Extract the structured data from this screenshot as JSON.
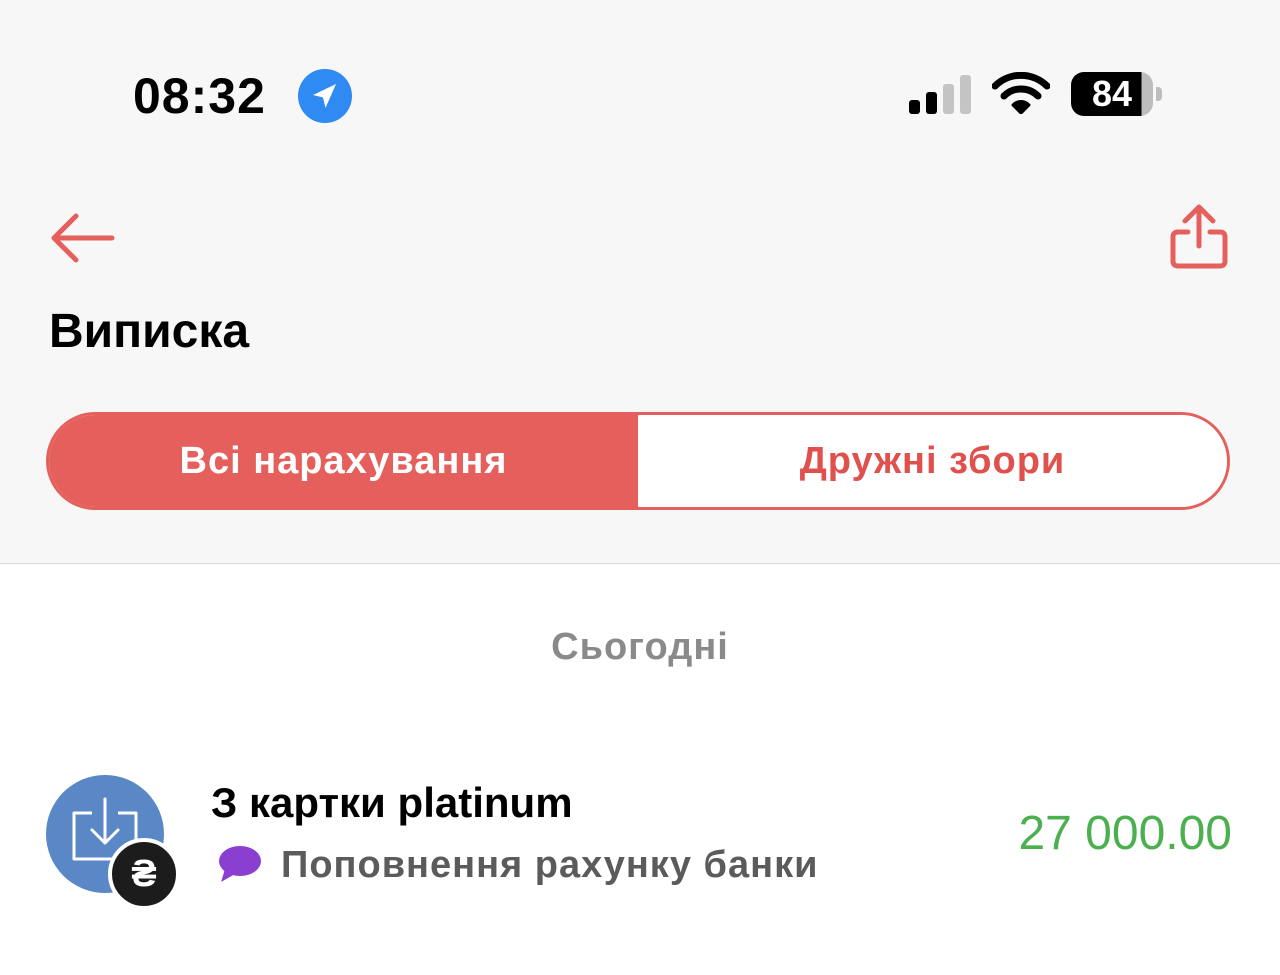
{
  "status_bar": {
    "time": "08:32",
    "battery_level": "84",
    "icons": [
      "location-arrow-icon",
      "cellular-signal-icon",
      "wifi-icon",
      "battery-icon"
    ]
  },
  "header": {
    "title": "Виписка",
    "back_icon": "arrow-left-icon",
    "share_icon": "share-icon"
  },
  "tabs": [
    {
      "label": "Всі нарахування",
      "active": true
    },
    {
      "label": "Дружні збори",
      "active": false
    }
  ],
  "transactions": {
    "date_group": "Сьогодні",
    "items": [
      {
        "title": "З картки platinum",
        "category": "Поповнення рахунку банки",
        "amount": "27 000.00",
        "currency_symbol": "₴",
        "icon": "download-icon",
        "comment_icon": "speech-bubble-icon"
      }
    ]
  },
  "colors": {
    "accent": "#e5605c",
    "amount_positive": "#4caf50",
    "avatar_bg": "#5a87c6",
    "comment_icon": "#8b3fd0",
    "location_blue": "#2f8af4"
  }
}
